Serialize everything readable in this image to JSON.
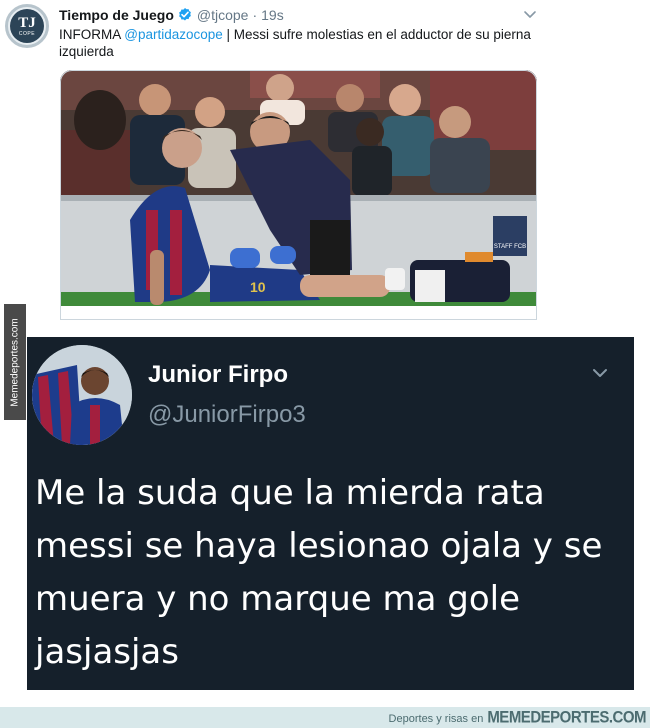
{
  "tweet1": {
    "avatar": {
      "logo_text": "TJ",
      "logo_subtext": "COPE"
    },
    "name": "Tiempo de Juego",
    "handle": "@tjcope",
    "separator": "·",
    "time": "19s",
    "text_prefix": "INFORMA ",
    "mention": "@partidazocope",
    "text_suffix": " | Messi sufre molestias en el adductor de su pierna izquierda",
    "photo": {
      "jersey_number": "10",
      "staff_badge": "STAFF FCB"
    }
  },
  "tweet2": {
    "name": "Junior Firpo",
    "handle": "@JuniorFirpo3",
    "text": "Me la suda que la mierda rata messi se haya lesionao ojala y se muera y no marque ma gole jasjasjas"
  },
  "watermark": {
    "side": "Memedeportes.com"
  },
  "footer": {
    "small": "Deportes y risas en",
    "brand": "MEMEDEPORTES.COM"
  },
  "colors": {
    "link": "#1b95e0",
    "verified": "#1da1f2",
    "dark_bg": "#15202b",
    "secondary": "#657786",
    "footer_bg": "#d8e8ea"
  }
}
